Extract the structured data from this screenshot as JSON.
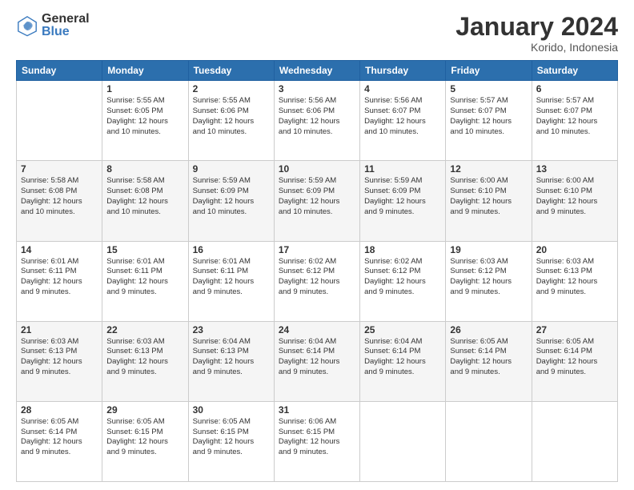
{
  "header": {
    "logo_general": "General",
    "logo_blue": "Blue",
    "month_title": "January 2024",
    "location": "Korido, Indonesia"
  },
  "days_of_week": [
    "Sunday",
    "Monday",
    "Tuesday",
    "Wednesday",
    "Thursday",
    "Friday",
    "Saturday"
  ],
  "weeks": [
    [
      {
        "day": "",
        "info": ""
      },
      {
        "day": "1",
        "info": "Sunrise: 5:55 AM\nSunset: 6:05 PM\nDaylight: 12 hours\nand 10 minutes."
      },
      {
        "day": "2",
        "info": "Sunrise: 5:55 AM\nSunset: 6:06 PM\nDaylight: 12 hours\nand 10 minutes."
      },
      {
        "day": "3",
        "info": "Sunrise: 5:56 AM\nSunset: 6:06 PM\nDaylight: 12 hours\nand 10 minutes."
      },
      {
        "day": "4",
        "info": "Sunrise: 5:56 AM\nSunset: 6:07 PM\nDaylight: 12 hours\nand 10 minutes."
      },
      {
        "day": "5",
        "info": "Sunrise: 5:57 AM\nSunset: 6:07 PM\nDaylight: 12 hours\nand 10 minutes."
      },
      {
        "day": "6",
        "info": "Sunrise: 5:57 AM\nSunset: 6:07 PM\nDaylight: 12 hours\nand 10 minutes."
      }
    ],
    [
      {
        "day": "7",
        "info": "Sunrise: 5:58 AM\nSunset: 6:08 PM\nDaylight: 12 hours\nand 10 minutes."
      },
      {
        "day": "8",
        "info": "Sunrise: 5:58 AM\nSunset: 6:08 PM\nDaylight: 12 hours\nand 10 minutes."
      },
      {
        "day": "9",
        "info": "Sunrise: 5:59 AM\nSunset: 6:09 PM\nDaylight: 12 hours\nand 10 minutes."
      },
      {
        "day": "10",
        "info": "Sunrise: 5:59 AM\nSunset: 6:09 PM\nDaylight: 12 hours\nand 10 minutes."
      },
      {
        "day": "11",
        "info": "Sunrise: 5:59 AM\nSunset: 6:09 PM\nDaylight: 12 hours\nand 9 minutes."
      },
      {
        "day": "12",
        "info": "Sunrise: 6:00 AM\nSunset: 6:10 PM\nDaylight: 12 hours\nand 9 minutes."
      },
      {
        "day": "13",
        "info": "Sunrise: 6:00 AM\nSunset: 6:10 PM\nDaylight: 12 hours\nand 9 minutes."
      }
    ],
    [
      {
        "day": "14",
        "info": "Sunrise: 6:01 AM\nSunset: 6:11 PM\nDaylight: 12 hours\nand 9 minutes."
      },
      {
        "day": "15",
        "info": "Sunrise: 6:01 AM\nSunset: 6:11 PM\nDaylight: 12 hours\nand 9 minutes."
      },
      {
        "day": "16",
        "info": "Sunrise: 6:01 AM\nSunset: 6:11 PM\nDaylight: 12 hours\nand 9 minutes."
      },
      {
        "day": "17",
        "info": "Sunrise: 6:02 AM\nSunset: 6:12 PM\nDaylight: 12 hours\nand 9 minutes."
      },
      {
        "day": "18",
        "info": "Sunrise: 6:02 AM\nSunset: 6:12 PM\nDaylight: 12 hours\nand 9 minutes."
      },
      {
        "day": "19",
        "info": "Sunrise: 6:03 AM\nSunset: 6:12 PM\nDaylight: 12 hours\nand 9 minutes."
      },
      {
        "day": "20",
        "info": "Sunrise: 6:03 AM\nSunset: 6:13 PM\nDaylight: 12 hours\nand 9 minutes."
      }
    ],
    [
      {
        "day": "21",
        "info": "Sunrise: 6:03 AM\nSunset: 6:13 PM\nDaylight: 12 hours\nand 9 minutes."
      },
      {
        "day": "22",
        "info": "Sunrise: 6:03 AM\nSunset: 6:13 PM\nDaylight: 12 hours\nand 9 minutes."
      },
      {
        "day": "23",
        "info": "Sunrise: 6:04 AM\nSunset: 6:13 PM\nDaylight: 12 hours\nand 9 minutes."
      },
      {
        "day": "24",
        "info": "Sunrise: 6:04 AM\nSunset: 6:14 PM\nDaylight: 12 hours\nand 9 minutes."
      },
      {
        "day": "25",
        "info": "Sunrise: 6:04 AM\nSunset: 6:14 PM\nDaylight: 12 hours\nand 9 minutes."
      },
      {
        "day": "26",
        "info": "Sunrise: 6:05 AM\nSunset: 6:14 PM\nDaylight: 12 hours\nand 9 minutes."
      },
      {
        "day": "27",
        "info": "Sunrise: 6:05 AM\nSunset: 6:14 PM\nDaylight: 12 hours\nand 9 minutes."
      }
    ],
    [
      {
        "day": "28",
        "info": "Sunrise: 6:05 AM\nSunset: 6:14 PM\nDaylight: 12 hours\nand 9 minutes."
      },
      {
        "day": "29",
        "info": "Sunrise: 6:05 AM\nSunset: 6:15 PM\nDaylight: 12 hours\nand 9 minutes."
      },
      {
        "day": "30",
        "info": "Sunrise: 6:05 AM\nSunset: 6:15 PM\nDaylight: 12 hours\nand 9 minutes."
      },
      {
        "day": "31",
        "info": "Sunrise: 6:06 AM\nSunset: 6:15 PM\nDaylight: 12 hours\nand 9 minutes."
      },
      {
        "day": "",
        "info": ""
      },
      {
        "day": "",
        "info": ""
      },
      {
        "day": "",
        "info": ""
      }
    ]
  ]
}
